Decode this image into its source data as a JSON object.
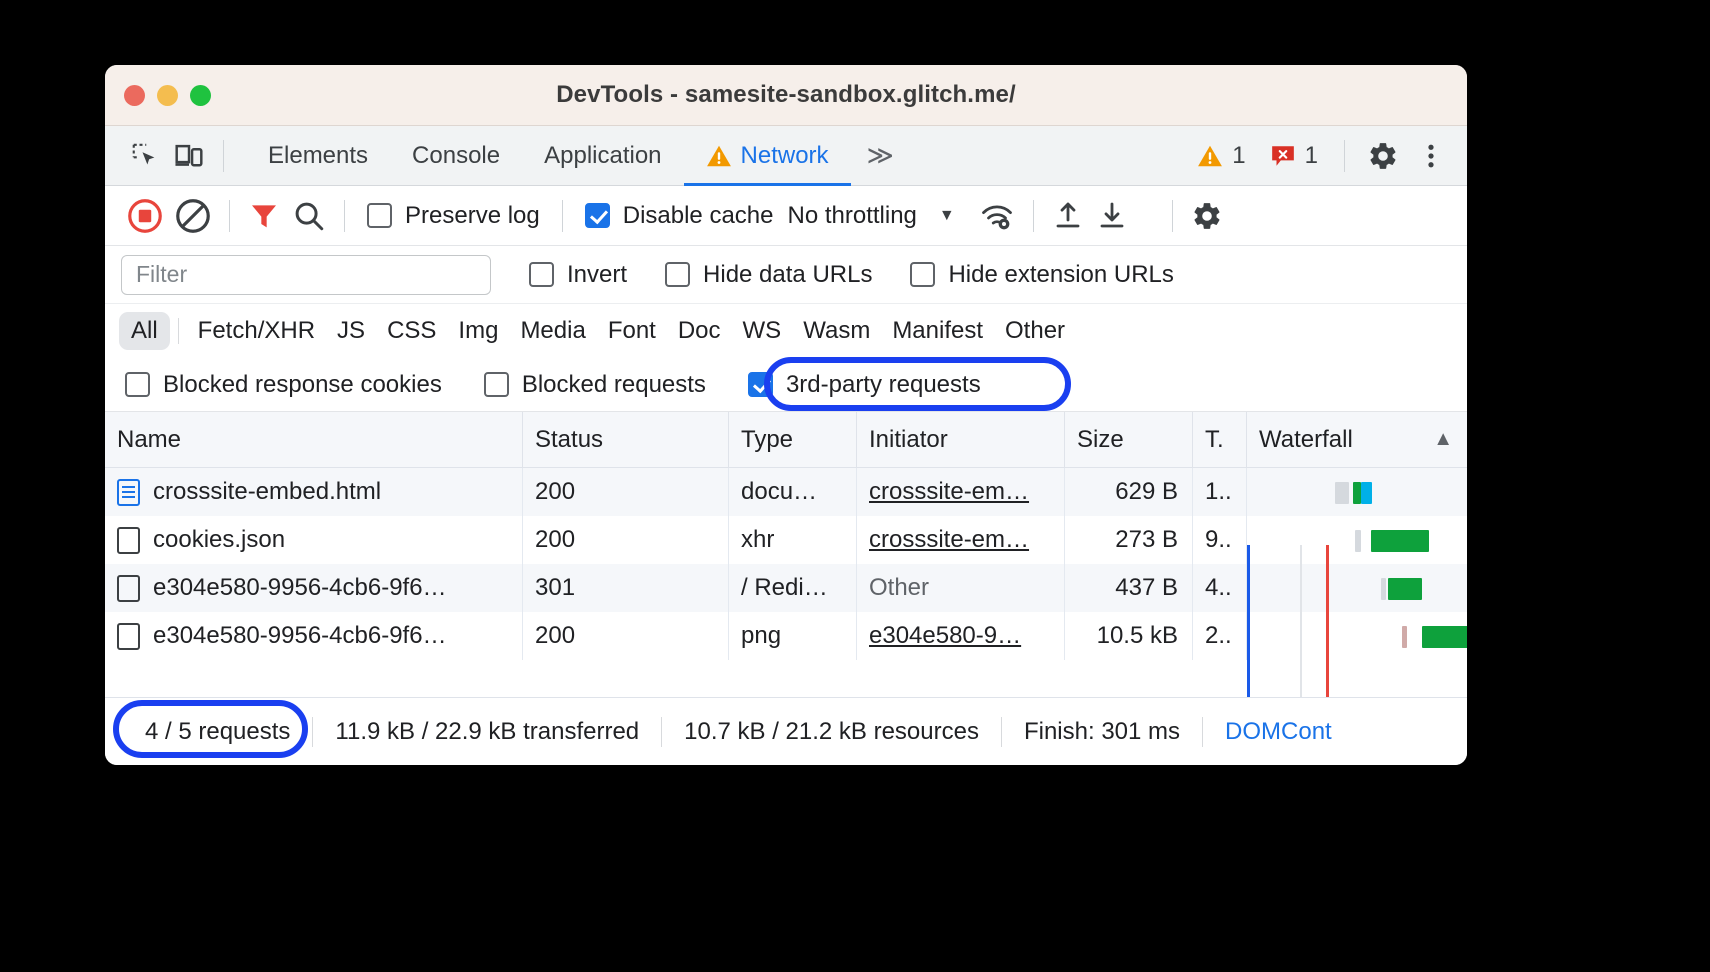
{
  "window": {
    "title": "DevTools - samesite-sandbox.glitch.me/",
    "traffic_lights": [
      "close",
      "minimize",
      "zoom"
    ]
  },
  "tabstrip": {
    "left_icons": [
      {
        "name": "inspect-element-icon",
        "label": "Inspect element"
      },
      {
        "name": "device-toolbar-icon",
        "label": "Toggle device toolbar"
      }
    ],
    "tabs": [
      {
        "label": "Elements",
        "active": false,
        "warning": false
      },
      {
        "label": "Console",
        "active": false,
        "warning": false
      },
      {
        "label": "Application",
        "active": false,
        "warning": false
      },
      {
        "label": "Network",
        "active": true,
        "warning": true
      }
    ],
    "more_tabs": "≫",
    "warning_count": "1",
    "error_count": "1",
    "settings_label": "Settings",
    "more_options_label": "Customize and control DevTools"
  },
  "network_toolbar": {
    "record_label": "Stop recording network log",
    "clear_label": "Clear network log",
    "filter_label": "Filter",
    "search_label": "Search",
    "preserve_log": {
      "label": "Preserve log",
      "checked": false
    },
    "disable_cache": {
      "label": "Disable cache",
      "checked": true
    },
    "throttling": {
      "value": "No throttling",
      "caret": "▼"
    },
    "network_conditions_label": "Network conditions",
    "import_label": "Import HAR file",
    "export_label": "Export HAR file",
    "settings_label": "Network settings"
  },
  "filter_row": {
    "input_placeholder": "Filter",
    "input_value": "",
    "checks": [
      {
        "label": "Invert",
        "checked": false
      },
      {
        "label": "Hide data URLs",
        "checked": false
      },
      {
        "label": "Hide extension URLs",
        "checked": false
      }
    ]
  },
  "type_filters": {
    "all": "All",
    "items": [
      "Fetch/XHR",
      "JS",
      "CSS",
      "Img",
      "Media",
      "Font",
      "Doc",
      "WS",
      "Wasm",
      "Manifest",
      "Other"
    ],
    "active": "All"
  },
  "cookie_filters": [
    {
      "label": "Blocked response cookies",
      "checked": false,
      "highlighted": false
    },
    {
      "label": "Blocked requests",
      "checked": false,
      "highlighted": false
    },
    {
      "label": "3rd-party requests",
      "checked": true,
      "highlighted": true
    }
  ],
  "table": {
    "columns": [
      "Name",
      "Status",
      "Type",
      "Initiator",
      "Size",
      "T.",
      "Waterfall"
    ],
    "sort_indicator": "▲",
    "rows": [
      {
        "icon": "document-icon",
        "name": "crosssite-embed.html",
        "status": "200",
        "type": "docu…",
        "initiator": "crosssite-em…",
        "initiator_is_link": true,
        "size": "629 B",
        "time": "1..",
        "selected": false
      },
      {
        "icon": "generic-file-icon",
        "name": "cookies.json",
        "status": "200",
        "type": "xhr",
        "initiator": "crosssite-em…",
        "initiator_is_link": true,
        "size": "273 B",
        "time": "9..",
        "selected": false
      },
      {
        "icon": "generic-file-icon",
        "name": "e304e580-9956-4cb6-9f6…",
        "status": "301",
        "type": "/ Redi…",
        "initiator": "Other",
        "initiator_is_link": false,
        "size": "437 B",
        "time": "4..",
        "selected": false
      },
      {
        "icon": "generic-file-icon",
        "name": "e304e580-9956-4cb6-9f6…",
        "status": "200",
        "type": "png",
        "initiator": "e304e580-9…",
        "initiator_is_link": true,
        "size": "10.5 kB",
        "time": "2..",
        "selected": false
      }
    ]
  },
  "status_bar": {
    "requests": "4 / 5 requests",
    "transferred": "11.9 kB / 22.9 kB transferred",
    "resources": "10.7 kB / 21.2 kB resources",
    "finish": "Finish: 301 ms",
    "domcontentloaded": "DOMCont"
  },
  "colors": {
    "accent_blue": "#1a73e8",
    "annotation_blue": "#1a3ff0",
    "warning_orange": "#f29900",
    "error_red": "#d93025",
    "record_red": "#e8453c",
    "waterfall_green": "#0eA13c",
    "waterfall_cyan": "#00b0e8",
    "dom_line_blue": "#1a5ae8",
    "load_line_red": "#e8453c"
  }
}
